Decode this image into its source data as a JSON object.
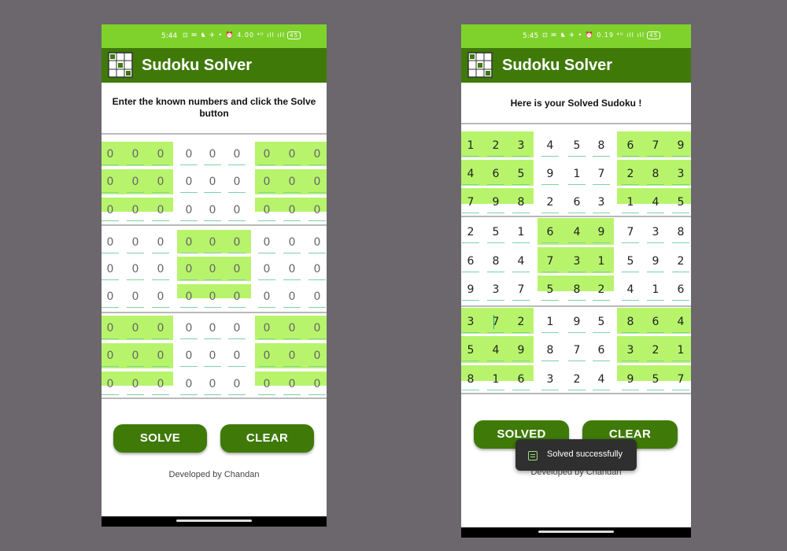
{
  "app": {
    "title": "Sudoku Solver"
  },
  "left": {
    "time": "5:44",
    "status_icons": "⊡ ✉ ♞ ✈ • ⏰ 4.00 ⁴ᴳ ıll ıll",
    "battery": "45",
    "instruction": "Enter the known numbers and click the Solve button",
    "grid": [
      [
        "0",
        "0",
        "0",
        "0",
        "0",
        "0",
        "0",
        "0",
        "0"
      ],
      [
        "0",
        "0",
        "0",
        "0",
        "0",
        "0",
        "0",
        "0",
        "0"
      ],
      [
        "0",
        "0",
        "0",
        "0",
        "0",
        "0",
        "0",
        "0",
        "0"
      ],
      [
        "0",
        "0",
        "0",
        "0",
        "0",
        "0",
        "0",
        "0",
        "0"
      ],
      [
        "0",
        "0",
        "0",
        "0",
        "0",
        "0",
        "0",
        "0",
        "0"
      ],
      [
        "0",
        "0",
        "0",
        "0",
        "0",
        "0",
        "0",
        "0",
        "0"
      ],
      [
        "0",
        "0",
        "0",
        "0",
        "0",
        "0",
        "0",
        "0",
        "0"
      ],
      [
        "0",
        "0",
        "0",
        "0",
        "0",
        "0",
        "0",
        "0",
        "0"
      ],
      [
        "0",
        "0",
        "0",
        "0",
        "0",
        "0",
        "0",
        "0",
        "0"
      ]
    ],
    "solve_label": "SOLVE",
    "clear_label": "CLEAR",
    "footer": "Developed by Chandan"
  },
  "right": {
    "time": "5:45",
    "status_icons": "⊡ ✉ ♞ ✈ • ⏰ 0.19 ⁴ᴳ ıll ıll",
    "battery": "45",
    "instruction": "Here is your Solved Sudoku !",
    "grid": [
      [
        "1",
        "2",
        "3",
        "4",
        "5",
        "8",
        "6",
        "7",
        "9"
      ],
      [
        "4",
        "6",
        "5",
        "9",
        "1",
        "7",
        "2",
        "8",
        "3"
      ],
      [
        "7",
        "9",
        "8",
        "2",
        "6",
        "3",
        "1",
        "4",
        "5"
      ],
      [
        "2",
        "5",
        "1",
        "6",
        "4",
        "9",
        "7",
        "3",
        "8"
      ],
      [
        "6",
        "8",
        "4",
        "7",
        "3",
        "1",
        "5",
        "9",
        "2"
      ],
      [
        "9",
        "3",
        "7",
        "5",
        "8",
        "2",
        "4",
        "1",
        "6"
      ],
      [
        "3",
        "7",
        "2",
        "1",
        "9",
        "5",
        "8",
        "6",
        "4"
      ],
      [
        "5",
        "4",
        "9",
        "8",
        "7",
        "6",
        "3",
        "2",
        "1"
      ],
      [
        "8",
        "1",
        "6",
        "3",
        "2",
        "4",
        "9",
        "5",
        "7"
      ]
    ],
    "solve_label": "SOLVED",
    "clear_label": "CLEAR",
    "footer": "Developed by Chandan",
    "toast": "Solved successfully"
  },
  "colors": {
    "appbar": "#3f7a08",
    "statusbar": "#7fd22b",
    "box": "#b7f46c"
  }
}
